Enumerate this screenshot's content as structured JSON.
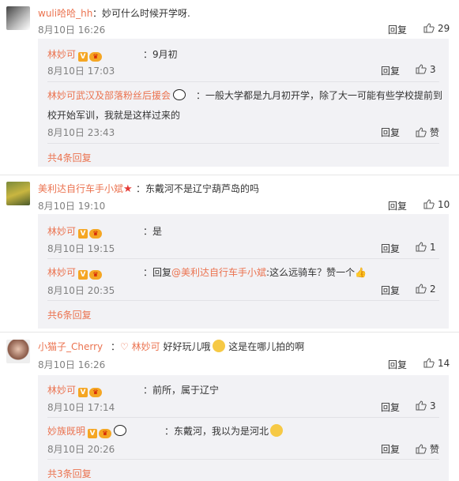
{
  "c1": {
    "user": "wuli哈哈_hh",
    "text": "：妙可什么时候开学呀.",
    "time": "8月10日 16:26",
    "reply": "回复",
    "likes": "29",
    "replies": [
      {
        "user": "林妙可",
        "text": "：9月初",
        "time": "8月10日 17:03",
        "reply": "回复",
        "likes": "3"
      },
      {
        "user": "林妙可武汉及部落粉丝后援会",
        "text": "：一般大学都是九月初开学，除了大一可能有些学校提前到",
        "text2": "校开始军训，我就是这样过来的",
        "time": "8月10日 23:43",
        "reply": "回复",
        "likes": "赞"
      }
    ],
    "more": "共4条回复"
  },
  "c2": {
    "user": "美利达自行车手小斌",
    "text": "：东戴河不是辽宁葫芦岛的吗",
    "time": "8月10日 19:10",
    "reply": "回复",
    "likes": "10",
    "replies": [
      {
        "user": "林妙可",
        "text": "：是",
        "time": "8月10日 19:15",
        "reply": "回复",
        "likes": "1"
      },
      {
        "user": "林妙可",
        "text_pre": "：回复",
        "mention": "@美利达自行车手小斌",
        "text": ":这么远骑车？赞一个",
        "time": "8月10日 20:35",
        "reply": "回复",
        "likes": "2"
      }
    ],
    "more": "共6条回复"
  },
  "c3": {
    "user": "小猫子_Cherry",
    "text_pre": "：",
    "mention": "林妙可",
    "text": " 好好玩儿哦",
    "text_after": " 这是在哪儿拍的啊",
    "time": "8月10日 16:26",
    "reply": "回复",
    "likes": "14",
    "replies": [
      {
        "user": "林妙可",
        "text": "：前所，属于辽宁",
        "time": "8月10日 17:14",
        "reply": "回复",
        "likes": "3"
      },
      {
        "user": "妙族既明",
        "text": "：东戴河，我以为是河北",
        "time": "8月10日 20:26",
        "reply": "回复",
        "likes": "赞"
      }
    ],
    "more": "共3条回复"
  },
  "colors": {
    "accent": "#eb7350",
    "reply_bg": "#f2f2f5",
    "time": "#808080"
  },
  "icons": [
    "thumb-up-icon",
    "verified-v-icon",
    "level-badge-icon",
    "panda-icon",
    "star-icon",
    "emoji-icon"
  ]
}
